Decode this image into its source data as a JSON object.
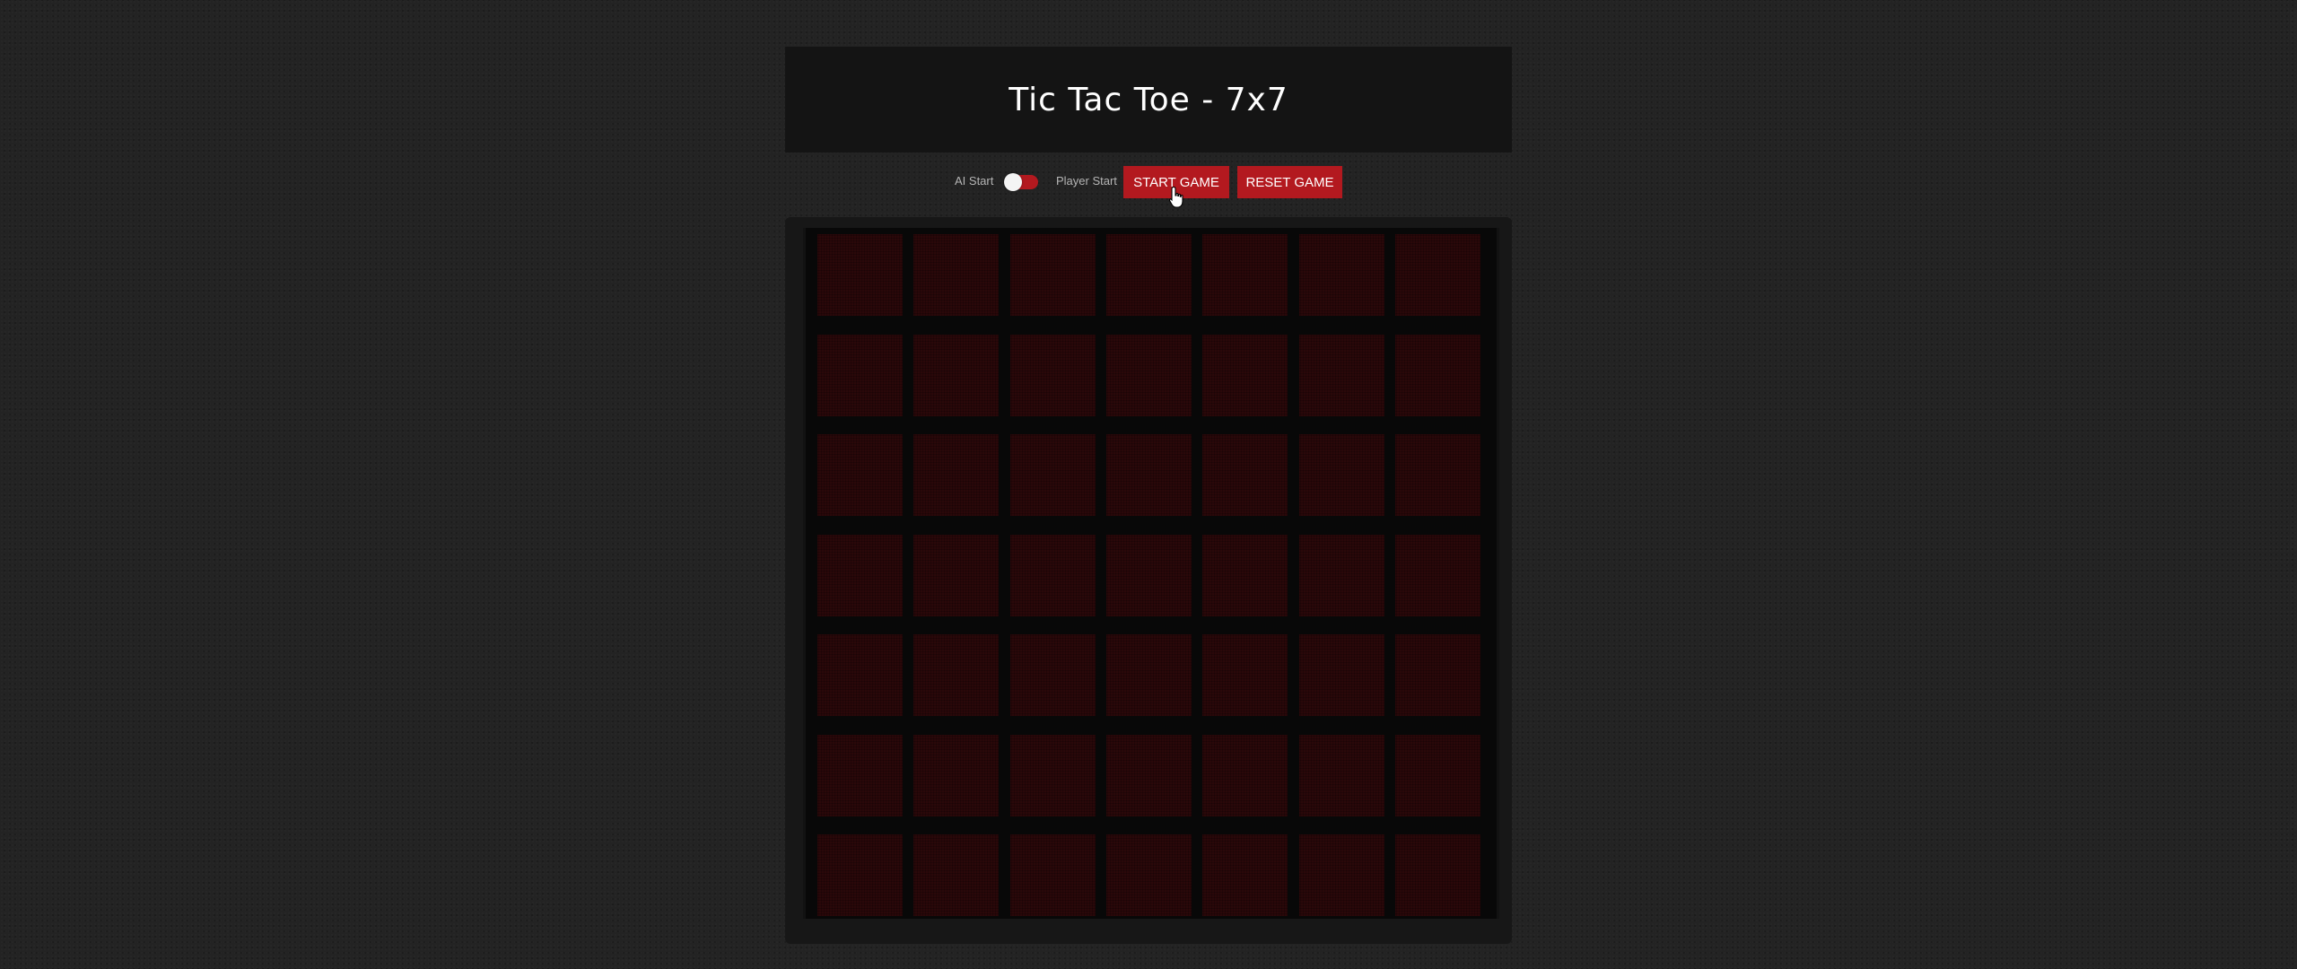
{
  "header": {
    "title": "Tic Tac Toe - 7x7"
  },
  "controls": {
    "ai_start_label": "AI Start",
    "player_start_label": "Player Start",
    "toggle_state": "ai-start",
    "start_button_label": "START GAME",
    "reset_button_label": "RESET GAME"
  },
  "board": {
    "rows": 7,
    "cols": 7,
    "cells": [
      [
        "",
        "",
        "",
        "",
        "",
        "",
        ""
      ],
      [
        "",
        "",
        "",
        "",
        "",
        "",
        ""
      ],
      [
        "",
        "",
        "",
        "",
        "",
        "",
        ""
      ],
      [
        "",
        "",
        "",
        "",
        "",
        "",
        ""
      ],
      [
        "",
        "",
        "",
        "",
        "",
        "",
        ""
      ],
      [
        "",
        "",
        "",
        "",
        "",
        "",
        ""
      ],
      [
        "",
        "",
        "",
        "",
        "",
        "",
        ""
      ]
    ]
  },
  "colors": {
    "accent": "#b3191f",
    "cell": "#2a0809",
    "background": "#232323"
  },
  "icons": {
    "cursor": "hand-pointer-icon"
  }
}
